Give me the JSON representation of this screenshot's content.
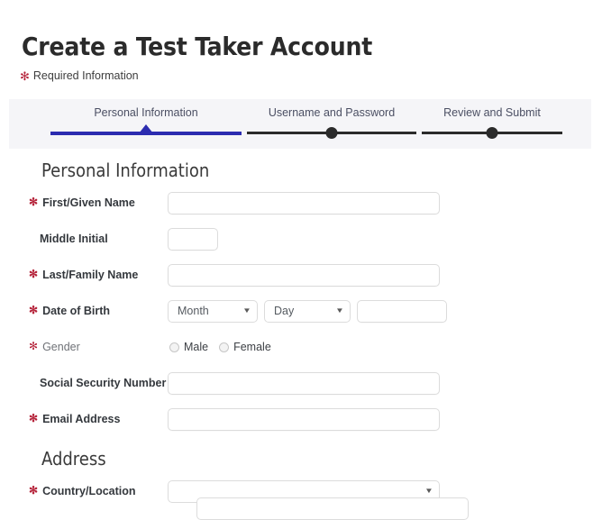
{
  "header": {
    "title": "Create a Test Taker Account",
    "required_note": "Required Information",
    "required_marker": "✻"
  },
  "stepper": {
    "steps": [
      {
        "label": "Personal Information",
        "state": "active",
        "marker": "triangle"
      },
      {
        "label": "Username and Password",
        "state": "upcoming",
        "marker": "circle"
      },
      {
        "label": "Review and Submit",
        "state": "upcoming",
        "marker": "circle"
      }
    ],
    "active_color": "#2c2cb0",
    "inactive_color": "#2b2b2b",
    "band_color": "#f5f5f8",
    "label_color": "#4b4f63"
  },
  "sections": {
    "personal": {
      "heading": "Personal Information",
      "fields": {
        "first_name": {
          "label": "First/Given Name",
          "required": true,
          "value": "",
          "placeholder": ""
        },
        "middle_initial": {
          "label": "Middle Initial",
          "required": false,
          "value": "",
          "placeholder": ""
        },
        "last_name": {
          "label": "Last/Family Name",
          "required": true,
          "value": "",
          "placeholder": ""
        },
        "dob": {
          "label": "Date of Birth",
          "required": true,
          "month_value": "Month",
          "day_value": "Day",
          "year_value": "",
          "caret": "▼"
        },
        "gender": {
          "label": "Gender",
          "required": true,
          "options": [
            {
              "label": "Male",
              "selected": false
            },
            {
              "label": "Female",
              "selected": false
            }
          ]
        },
        "ssn": {
          "label": "Social Security Number",
          "required": false,
          "value": "",
          "placeholder": ""
        },
        "email": {
          "label": "Email Address",
          "required": true,
          "value": "",
          "placeholder": ""
        }
      }
    },
    "address": {
      "heading": "Address",
      "fields": {
        "country": {
          "label": "Country/Location",
          "required": true,
          "value": "",
          "caret": "▼"
        }
      }
    }
  },
  "colors": {
    "required_star": "#b5233a",
    "label_text": "#34383d",
    "heading_text": "#3a3a3a",
    "field_border": "#dcdcdc",
    "page_background": "#ffffff"
  }
}
